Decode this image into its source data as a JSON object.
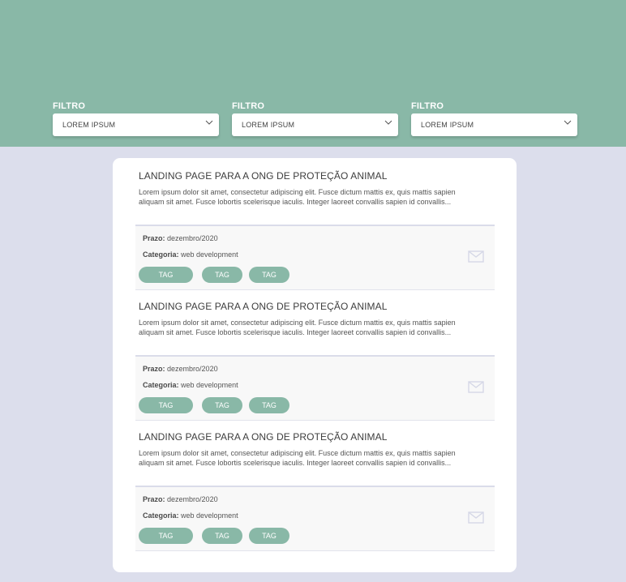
{
  "filters": [
    {
      "label": "FILTRO",
      "value": "LOREM IPSUM"
    },
    {
      "label": "FILTRO",
      "value": "LOREM IPSUM"
    },
    {
      "label": "FILTRO",
      "value": "LOREM IPSUM"
    }
  ],
  "cards": [
    {
      "title": "LANDING PAGE PARA A ONG DE PROTEÇÃO ANIMAL",
      "description": "Lorem ipsum dolor sit amet, consectetur adipiscing elit. Fusce dictum mattis ex, quis mattis sapien aliquam sit amet. Fusce lobortis scelerisque iaculis. Integer laoreet convallis sapien id convallis...",
      "prazo_label": "Prazo:",
      "prazo_value": "dezembro/2020",
      "categoria_label": "Categoria:",
      "categoria_value": "web development",
      "tags": [
        "TAG",
        "TAG",
        "TAG"
      ]
    },
    {
      "title": "LANDING PAGE PARA A ONG DE PROTEÇÃO ANIMAL",
      "description": "Lorem ipsum dolor sit amet, consectetur adipiscing elit. Fusce dictum mattis ex, quis mattis sapien aliquam sit amet. Fusce lobortis scelerisque iaculis. Integer laoreet convallis sapien id convallis...",
      "prazo_label": "Prazo:",
      "prazo_value": "dezembro/2020",
      "categoria_label": "Categoria:",
      "categoria_value": "web development",
      "tags": [
        "TAG",
        "TAG",
        "TAG"
      ]
    },
    {
      "title": "LANDING PAGE PARA A ONG DE PROTEÇÃO ANIMAL",
      "description": "Lorem ipsum dolor sit amet, consectetur adipiscing elit. Fusce dictum mattis ex, quis mattis sapien aliquam sit amet. Fusce lobortis scelerisque iaculis. Integer laoreet convallis sapien id convallis...",
      "prazo_label": "Prazo:",
      "prazo_value": "dezembro/2020",
      "categoria_label": "Categoria:",
      "categoria_value": "web development",
      "tags": [
        "TAG",
        "TAG",
        "TAG"
      ]
    }
  ],
  "icons": {
    "dropdown": "chevron-down-icon",
    "contact": "mail-icon"
  },
  "colors": {
    "header": "#89b8a7",
    "background": "#dcdeec",
    "tag": "#89b8a7",
    "panel": "#ffffff"
  }
}
